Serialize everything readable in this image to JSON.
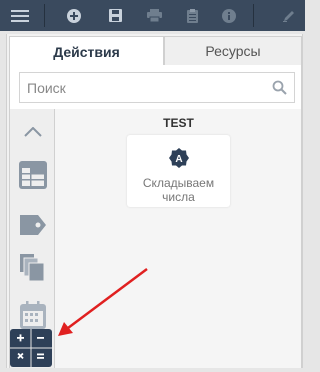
{
  "toolbar": {
    "buttons": [
      "menu-icon",
      "add-icon",
      "save-icon",
      "print-icon",
      "clipboard-icon",
      "info-icon",
      "edit-icon"
    ]
  },
  "tabs": {
    "actions": "Действия",
    "resources": "Ресурсы"
  },
  "search": {
    "placeholder": "Поиск"
  },
  "categories": [
    "collapse-up-icon",
    "table-icon",
    "tag-icon",
    "copy-icon",
    "calendar-icon",
    "calculator-icon"
  ],
  "group": {
    "title": "TEST"
  },
  "block": {
    "label": "Складываем числа",
    "icon": "a-badge-icon"
  },
  "colors": {
    "toolbar": "#3a4a5e",
    "category_icon": "#2e4058",
    "arrow": "#e02020"
  }
}
